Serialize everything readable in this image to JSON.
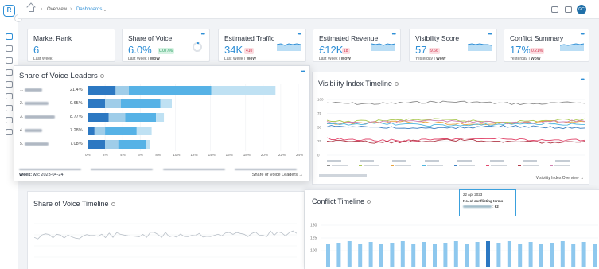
{
  "sidebar": {
    "logo_text": "R",
    "collapse_glyph": "›",
    "icons": [
      "edit-icon",
      "chart-icon",
      "bookmark-icon",
      "flag-icon",
      "database-icon",
      "settings-icon",
      "file-icon",
      "pin-icon",
      "stack-icon",
      "user-icon"
    ]
  },
  "topbar": {
    "crumbs": [
      "Overview",
      "Dashboards"
    ],
    "avatar_text": "GC"
  },
  "kpis": [
    {
      "title": "Market Rank",
      "value": "6",
      "foot": "Last Week",
      "badge": "",
      "trend": ""
    },
    {
      "title": "Share of Voice",
      "value": "6.0%",
      "foot": "Last Week",
      "foot_extra": "WoW",
      "badge": "0.077%",
      "trend": "up"
    },
    {
      "title": "Estimated Traffic",
      "value": "34K",
      "foot": "Last Week",
      "foot_extra": "WoW",
      "badge": "410",
      "trend": "down"
    },
    {
      "title": "Estimated Revenue",
      "value": "£12K",
      "foot": "Last Week",
      "foot_extra": "WoW",
      "badge": "18",
      "trend": "down"
    },
    {
      "title": "Visibility Score",
      "value": "57",
      "foot": "Yesterday",
      "foot_extra": "WoW",
      "badge": "9.66",
      "trend": "down"
    },
    {
      "title": "Conflict Summary",
      "value": "17%",
      "foot": "Yesterday",
      "foot_extra": "WoW",
      "badge": "0.21%",
      "trend": "down"
    }
  ],
  "sov": {
    "title": "Share of Voice Leaders",
    "week_label": "Week:",
    "week_value": "w/c 2023-04-24",
    "link": "Share of Voice Leaders",
    "ticks": [
      "0%",
      "2%",
      "4%",
      "6%",
      "8%",
      "10%",
      "12%",
      "14%",
      "16%",
      "18%",
      "20%",
      "22%",
      "24%"
    ],
    "rows": [
      {
        "rank": "1.",
        "pct": "21.4%",
        "segments": [
          3.2,
          1.5,
          9.4,
          7.3
        ]
      },
      {
        "rank": "2.",
        "pct": "9.65%",
        "segments": [
          2.0,
          1.8,
          4.5,
          1.3
        ]
      },
      {
        "rank": "3.",
        "pct": "8.77%",
        "segments": [
          2.4,
          1.9,
          3.5,
          0.9
        ]
      },
      {
        "rank": "4.",
        "pct": "7.28%",
        "segments": [
          0.8,
          1.2,
          3.6,
          1.7
        ]
      },
      {
        "rank": "5.",
        "pct": "7.08%",
        "segments": [
          2.0,
          1.5,
          3.2,
          0.4
        ]
      }
    ],
    "segment_colors": [
      "#2c78c2",
      "#9fcde9",
      "#56b2e6",
      "#bfe1f3"
    ]
  },
  "visibility": {
    "title": "Visibility Index Timeline",
    "link": "Visibility Index Overview",
    "y_ticks": [
      "100",
      "75",
      "50",
      "25",
      "0"
    ],
    "series_colors": [
      "#8c8c8c",
      "#a9c84f",
      "#e8a33d",
      "#4fb6e0",
      "#3a7fc2",
      "#e24a6e",
      "#b23a48",
      "#d07fb0"
    ]
  },
  "sov_timeline": {
    "title": "Share of Voice Timeline"
  },
  "conflict": {
    "title": "Conflict Timeline",
    "y_ticks": [
      "150",
      "125",
      "100"
    ],
    "popup_date": "22 Apr 2023",
    "popup_label": "No. of conflicting terms",
    "popup_value": "62"
  }
}
